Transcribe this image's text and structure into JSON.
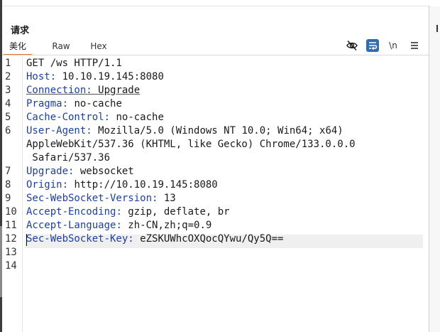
{
  "panel": {
    "title": "请求"
  },
  "tabs": [
    {
      "label": "美化",
      "active": true
    },
    {
      "label": "Raw",
      "active": false
    },
    {
      "label": "Hex",
      "active": false
    }
  ],
  "toolbar": {
    "hide_icon": "eye-slash-icon",
    "wrap_icon": "word-wrap-icon",
    "newline_label": "\\n",
    "menu_icon": "hamburger-menu-icon",
    "active_color": "#2e6db0",
    "tab_accent_color": "#e8702a",
    "header_name_color": "#1c3fa8"
  },
  "request": {
    "lines": [
      {
        "num": "1",
        "text": "GET /ws HTTP/1.1"
      },
      {
        "num": "2",
        "name": "Host",
        "value": "10.10.19.145:8080"
      },
      {
        "num": "3",
        "name": "Connection",
        "value": "Upgrade"
      },
      {
        "num": "4",
        "name": "Pragma",
        "value": "no-cache"
      },
      {
        "num": "5",
        "name": "Cache-Control",
        "value": "no-cache"
      },
      {
        "num": "6",
        "name": "User-Agent",
        "value": "Mozilla/5.0 (Windows NT 10.0; Win64; x64)",
        "wrap1": "AppleWebKit/537.36 (KHTML, like Gecko) Chrome/133.0.0.0",
        "wrap2": " Safari/537.36"
      },
      {
        "num": "7",
        "name": "Upgrade",
        "value": "websocket"
      },
      {
        "num": "8",
        "name": "Origin",
        "value": "http://10.10.19.145:8080"
      },
      {
        "num": "9",
        "name": "Sec-WebSocket-Version",
        "value": "13"
      },
      {
        "num": "10",
        "name": "Accept-Encoding",
        "value": "gzip, deflate, br"
      },
      {
        "num": "11",
        "name": "Accept-Language",
        "value": "zh-CN,zh;q=0.9"
      },
      {
        "num": "12",
        "name": "Sec-WebSocket-Key",
        "value": "eZSKUWhcOXQocQYwu/Qy5Q=="
      },
      {
        "num": "13",
        "text": ""
      },
      {
        "num": "14",
        "text": ""
      }
    ]
  }
}
